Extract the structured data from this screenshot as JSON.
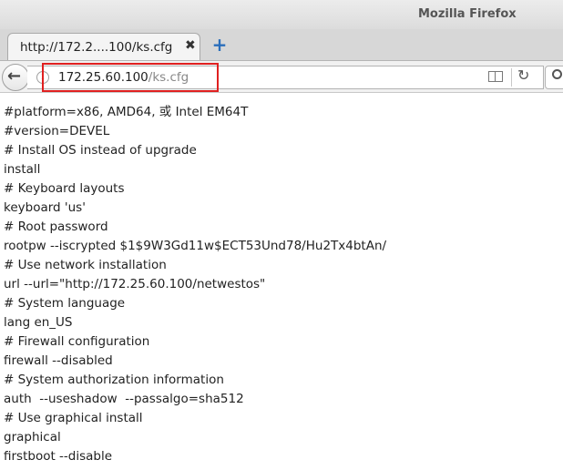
{
  "window": {
    "title": "Mozilla Firefox"
  },
  "tab": {
    "label": "http://172.2....100/ks.cfg",
    "close_glyph": "✖"
  },
  "new_tab_glyph": "+",
  "nav": {
    "back_glyph": "←",
    "info_glyph": "i",
    "reload_glyph": "↻"
  },
  "url": {
    "host": "172.25.60.100",
    "path": "/ks.cfg"
  },
  "highlight_color": "#e02020",
  "content_lines": [
    "#platform=x86, AMD64, 或 Intel EM64T",
    "#version=DEVEL",
    "# Install OS instead of upgrade",
    "install",
    "# Keyboard layouts",
    "keyboard 'us'",
    "# Root password",
    "rootpw --iscrypted $1$9W3Gd11w$ECT53Und78/Hu2Tx4btAn/",
    "# Use network installation",
    "url --url=\"http://172.25.60.100/netwestos\"",
    "# System language",
    "lang en_US",
    "# Firewall configuration",
    "firewall --disabled",
    "# System authorization information",
    "auth  --useshadow  --passalgo=sha512",
    "# Use graphical install",
    "graphical",
    "firstboot --disable"
  ]
}
